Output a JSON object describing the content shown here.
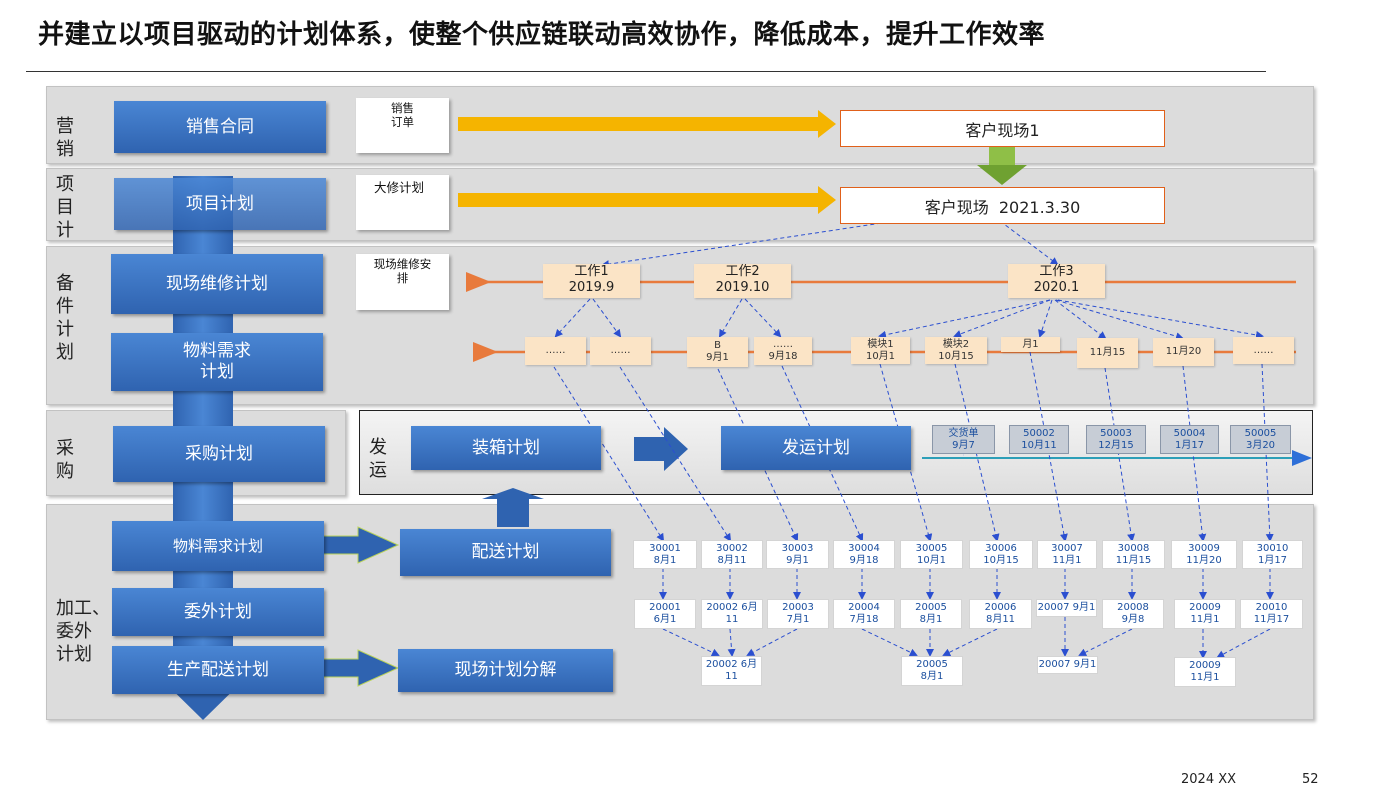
{
  "title": "并建立以项目驱动的计划体系，使整个供应链联动高效协作，降低成本，提升工作效率",
  "rows": {
    "marketing": "营\n销",
    "project": "项\n目\n计\n划",
    "spares": "备\n件\n计\n划",
    "purchase": "采\n购",
    "processing": "加工、\n委外\n计划",
    "ship": "发\n运"
  },
  "boxes": {
    "sales_contract": "销售合同",
    "project_plan": "项目计划",
    "site_repair_plan": "现场维修计划",
    "material_req_1": "物料需求\n计划",
    "purchase_plan": "采购计划",
    "material_req_2": "物料需求计划",
    "outsource_plan": "委外计划",
    "prod_delivery_plan": "生产配送计划",
    "packing_plan": "装箱计划",
    "shipping_plan": "发运计划",
    "delivery_plan": "配送计划",
    "site_plan_breakdown": "现场计划分解"
  },
  "notes": {
    "sales_order": "销售\n订单",
    "overhaul_plan": "大修计划",
    "site_repair_arrangement": "现场维修安\n排"
  },
  "sites": {
    "site1": "客户现场1",
    "site2": "客户现场  2021.3.30"
  },
  "works": [
    {
      "name": "工作1",
      "date": "2019.9"
    },
    {
      "name": "工作2",
      "date": "2019.10"
    },
    {
      "name": "工作3",
      "date": "2020.1"
    }
  ],
  "subtasks": [
    {
      "l1": "……",
      "l2": ""
    },
    {
      "l1": "……",
      "l2": ""
    },
    {
      "l1": "B",
      "l2": "9月1"
    },
    {
      "l1": "……",
      "l2": "9月18"
    },
    {
      "l1": "模块1",
      "l2": "10月1"
    },
    {
      "l1": "模块2",
      "l2": "10月15"
    },
    {
      "l1": "月1",
      "l2": ""
    },
    {
      "l1": "11月15",
      "l2": ""
    },
    {
      "l1": "11月20",
      "l2": ""
    },
    {
      "l1": "……",
      "l2": ""
    }
  ],
  "shipments": [
    {
      "l1": "交货单",
      "l2": "9月7"
    },
    {
      "l1": "50002",
      "l2": "10月11"
    },
    {
      "l1": "50003",
      "l2": "12月15"
    },
    {
      "l1": "50004",
      "l2": "1月17"
    },
    {
      "l1": "50005",
      "l2": "3月20"
    }
  ],
  "nodes_row1": [
    {
      "l1": "30001",
      "l2": "8月1"
    },
    {
      "l1": "30002",
      "l2": "8月11"
    },
    {
      "l1": "30003",
      "l2": "9月1"
    },
    {
      "l1": "30004",
      "l2": "9月18"
    },
    {
      "l1": "30005",
      "l2": "10月1"
    },
    {
      "l1": "30006",
      "l2": "10月15"
    },
    {
      "l1": "30007",
      "l2": "11月1"
    },
    {
      "l1": "30008",
      "l2": "11月15"
    },
    {
      "l1": "30009",
      "l2": "11月20"
    },
    {
      "l1": "30010",
      "l2": "1月17"
    }
  ],
  "nodes_row2": [
    {
      "l1": "20001",
      "l2": "6月1"
    },
    {
      "l1": "20002 6月",
      "l2": "11"
    },
    {
      "l1": "20003",
      "l2": "7月1"
    },
    {
      "l1": "20004",
      "l2": "7月18"
    },
    {
      "l1": "20005",
      "l2": "8月1"
    },
    {
      "l1": "20006",
      "l2": "8月11"
    },
    {
      "l1": "20007 9月1",
      "l2": ""
    },
    {
      "l1": "20008",
      "l2": "9月8"
    },
    {
      "l1": "20009",
      "l2": "11月1"
    },
    {
      "l1": "20010",
      "l2": "11月17"
    }
  ],
  "nodes_row3": [
    {
      "l1": "20002 6月",
      "l2": "11"
    },
    {
      "l1": "20005",
      "l2": "8月1"
    },
    {
      "l1": "20007 9月1",
      "l2": ""
    },
    {
      "l1": "20009",
      "l2": "11月1"
    }
  ],
  "footer": {
    "date": "2024 XX",
    "page": "52"
  },
  "colors": {
    "blue_box": "#3b74c4",
    "yellow_arrow": "#f5b400",
    "orange_line": "#e87a3c",
    "dashed_link": "#2b4fd0",
    "green_arrow": "#7fb03a",
    "work_fill": "#fbe4c6"
  }
}
